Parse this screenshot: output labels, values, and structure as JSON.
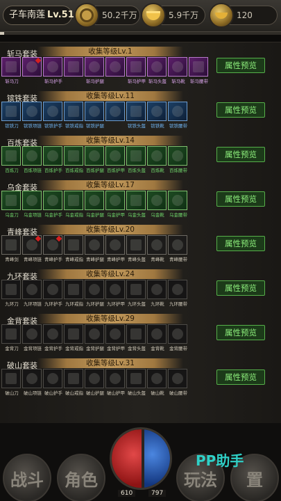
{
  "player": {
    "name": "子车南莲",
    "level": "Lv.51"
  },
  "resources": [
    {
      "icon": "coin-icon",
      "value": "50.2千万"
    },
    {
      "icon": "ingot-icon",
      "value": "5.9千万"
    },
    {
      "icon": "gold-ingot-icon",
      "value": "120"
    }
  ],
  "preview_label": "属性预览",
  "sets": [
    {
      "name": "斩马套装",
      "level": "收集等级Lv.1",
      "quality": "q-purple",
      "items": [
        {
          "cap": "斩马刀",
          "dot": false
        },
        {
          "cap": "",
          "dot": true
        },
        {
          "cap": "斩马护手",
          "dot": false
        },
        {
          "cap": "",
          "dot": false
        },
        {
          "cap": "斩马护腿",
          "dot": false
        },
        {
          "cap": "",
          "dot": false
        },
        {
          "cap": "斩马护甲",
          "dot": false
        },
        {
          "cap": "斩马头盔",
          "dot": false
        },
        {
          "cap": "斩马靴",
          "dot": false
        },
        {
          "cap": "斩马腰带",
          "dot": false
        }
      ]
    },
    {
      "name": "镔铁套装",
      "level": "收集等级Lv.11",
      "quality": "q-blue",
      "items": [
        {
          "cap": "镔铁刀",
          "dot": false
        },
        {
          "cap": "镔铁项链",
          "dot": false
        },
        {
          "cap": "镔铁护手",
          "dot": false
        },
        {
          "cap": "镔铁戒指",
          "dot": false
        },
        {
          "cap": "镔铁护腿",
          "dot": false
        },
        {
          "cap": "",
          "dot": false
        },
        {
          "cap": "镔铁头盔",
          "dot": false
        },
        {
          "cap": "镔铁靴",
          "dot": false
        },
        {
          "cap": "镔铁腰带",
          "dot": false
        }
      ]
    },
    {
      "name": "百炼套装",
      "level": "收集等级Lv.14",
      "quality": "q-green",
      "items": [
        {
          "cap": "百炼刀",
          "dot": false
        },
        {
          "cap": "百炼项链",
          "dot": false
        },
        {
          "cap": "百炼护手",
          "dot": false
        },
        {
          "cap": "百炼戒指",
          "dot": false
        },
        {
          "cap": "百炼护腿",
          "dot": false
        },
        {
          "cap": "百炼护甲",
          "dot": false
        },
        {
          "cap": "百炼头盔",
          "dot": false
        },
        {
          "cap": "百炼靴",
          "dot": false
        },
        {
          "cap": "百炼腰带",
          "dot": false
        }
      ]
    },
    {
      "name": "乌金套装",
      "level": "收集等级Lv.17",
      "quality": "q-green",
      "items": [
        {
          "cap": "乌金刀",
          "dot": false
        },
        {
          "cap": "乌金项链",
          "dot": false
        },
        {
          "cap": "乌金护手",
          "dot": false
        },
        {
          "cap": "乌金戒指",
          "dot": false
        },
        {
          "cap": "乌金护腿",
          "dot": false
        },
        {
          "cap": "乌金护甲",
          "dot": false
        },
        {
          "cap": "乌金头盔",
          "dot": false
        },
        {
          "cap": "乌金靴",
          "dot": false
        },
        {
          "cap": "乌金腰带",
          "dot": false
        }
      ]
    },
    {
      "name": "青峰套装",
      "level": "收集等级Lv.20",
      "quality": "q-white",
      "items": [
        {
          "cap": "青峰剑",
          "dot": false
        },
        {
          "cap": "青峰项链",
          "dot": true
        },
        {
          "cap": "青峰护手",
          "dot": true
        },
        {
          "cap": "青峰戒指",
          "dot": false
        },
        {
          "cap": "青峰护腿",
          "dot": false
        },
        {
          "cap": "青峰护甲",
          "dot": false
        },
        {
          "cap": "青峰头盔",
          "dot": false
        },
        {
          "cap": "青峰靴",
          "dot": false
        },
        {
          "cap": "青峰腰带",
          "dot": false
        }
      ]
    },
    {
      "name": "九环套装",
      "level": "收集等级Lv.24",
      "quality": "q-dark",
      "items": [
        {
          "cap": "九环刀",
          "dot": false
        },
        {
          "cap": "九环项链",
          "dot": false
        },
        {
          "cap": "九环护手",
          "dot": false
        },
        {
          "cap": "九环戒指",
          "dot": false
        },
        {
          "cap": "九环护腿",
          "dot": false
        },
        {
          "cap": "九环护甲",
          "dot": false
        },
        {
          "cap": "九环头盔",
          "dot": false
        },
        {
          "cap": "九环靴",
          "dot": false
        },
        {
          "cap": "九环腰带",
          "dot": false
        }
      ]
    },
    {
      "name": "金背套装",
      "level": "收集等级Lv.29",
      "quality": "q-dark",
      "items": [
        {
          "cap": "金背刀",
          "dot": false
        },
        {
          "cap": "金背项链",
          "dot": false
        },
        {
          "cap": "金背护手",
          "dot": false
        },
        {
          "cap": "金背戒指",
          "dot": false
        },
        {
          "cap": "金背护腿",
          "dot": false
        },
        {
          "cap": "金背护甲",
          "dot": false
        },
        {
          "cap": "金背头盔",
          "dot": false
        },
        {
          "cap": "金背靴",
          "dot": false
        },
        {
          "cap": "金背腰带",
          "dot": false
        }
      ]
    },
    {
      "name": "破山套装",
      "level": "收集等级Lv.31",
      "quality": "q-dark",
      "items": [
        {
          "cap": "破山刀",
          "dot": false
        },
        {
          "cap": "破山项链",
          "dot": false
        },
        {
          "cap": "破山护手",
          "dot": false
        },
        {
          "cap": "破山戒指",
          "dot": false
        },
        {
          "cap": "破山护腿",
          "dot": false
        },
        {
          "cap": "破山护甲",
          "dot": false
        },
        {
          "cap": "破山头盔",
          "dot": false
        },
        {
          "cap": "破山靴",
          "dot": false
        },
        {
          "cap": "破山腰带",
          "dot": false
        }
      ]
    }
  ],
  "bottom_nav": [
    {
      "label": "战斗",
      "name": "nav-battle-button"
    },
    {
      "label": "角色",
      "name": "nav-character-button"
    },
    {
      "label": "玩法",
      "name": "nav-gameplay-button"
    },
    {
      "label": "置",
      "name": "nav-settings-button"
    }
  ],
  "hp_value": "610",
  "mp_value": "797",
  "watermark": "PP助手",
  "colors": {
    "preview_text": "#8ef07d",
    "level_bar": "#c29a5c",
    "hp": "#e24848",
    "mp": "#4b86e0"
  }
}
